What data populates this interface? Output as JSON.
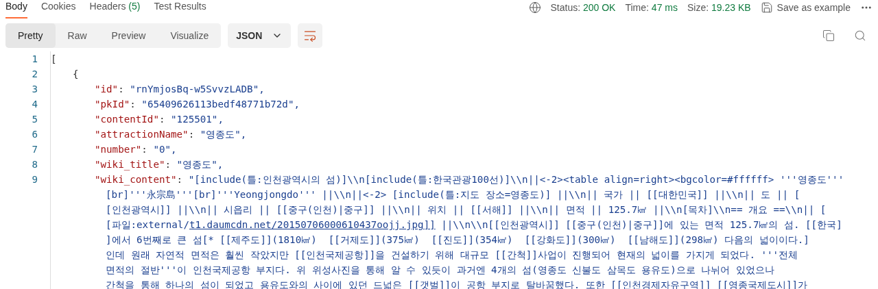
{
  "tabs": [
    {
      "label": "Body",
      "selected": true
    },
    {
      "label": "Cookies",
      "selected": false
    },
    {
      "label": "Headers",
      "count": "(5)",
      "selected": false
    },
    {
      "label": "Test Results",
      "selected": false
    }
  ],
  "status": {
    "items": [
      {
        "label": "Status:",
        "value": "200 OK"
      },
      {
        "label": "Time:",
        "value": "47 ms"
      },
      {
        "label": "Size:",
        "value": "19.23 KB"
      }
    ],
    "save": "Save as example"
  },
  "view_modes": [
    {
      "label": "Pretty",
      "selected": true
    },
    {
      "label": "Raw",
      "selected": false
    },
    {
      "label": "Preview",
      "selected": false
    },
    {
      "label": "Visualize",
      "selected": false
    }
  ],
  "format": "JSON",
  "wrap_lines": true,
  "code": [
    {
      "number": "1",
      "kind": "punct",
      "text": "[",
      "children": [
        {
          "number": "2",
          "kind": "punct",
          "text": "{",
          "children": [
            {
              "number": "3",
              "kind": "pair",
              "key": "\"id\"",
              "separator": ":",
              "value": "\"rnYmjosBq-w5SvvzLADB\","
            },
            {
              "number": "4",
              "kind": "pair",
              "key": "\"pkId\"",
              "separator": ":",
              "value": "\"65409626113bedf48771b72d\","
            },
            {
              "number": "5",
              "kind": "pair",
              "key": "\"contentId\"",
              "separator": ":",
              "value": "\"125501\","
            },
            {
              "number": "6",
              "kind": "pair",
              "key": "\"attractionName\"",
              "separator": ":",
              "value": "\"영종도\","
            },
            {
              "number": "7",
              "kind": "pair",
              "key": "\"number\"",
              "separator": ":",
              "value": "\"0\","
            },
            {
              "number": "8",
              "kind": "pair",
              "key": "\"wiki_title\"",
              "separator": ":",
              "value": "\"영종도\","
            },
            {
              "number": "9",
              "kind": "pair",
              "key": "\"wiki_content\"",
              "separator": ":",
              "value": "\"[include(틀:인천광역시의 섬)]\\\\n[include(틀:한국관광100선)]\\\\n||<-2><table align=right><bgcolor=#ffffff> '''영종도'''",
              "continuation": [
                {
                  "kind": "wrap",
                  "text": "[br]'''永宗島'''[br]'''Yeongjongdo''' ||\\\\n||<-2> [include(틀:지도 장소=영종도)] ||\\\\n|| 국가 || [[대한민국]] ||\\\\n|| 도 || ["
                },
                {
                  "kind": "wrap",
                  "text": "[인천광역시]] ||\\\\n|| 시읍리 || [[중구(인천)|중구]] ||\\\\n|| 위치 || [[서해]] ||\\\\n|| 면적 || 125.7㎢ ||\\\\n[목차]\\\\n== 개요 ==\\\\n|| ["
                },
                {
                  "kind": "link",
                  "before": "[파일:external/",
                  "link": "t1.daumcdn.net/20150706000610437oojj.jpg]]",
                  "after": " ||\\\\n\\\\n[[인천광역시]] [[중구(인천)|중구]]에 있는 면적 125.7㎢의 섬. [[한국]"
                },
                {
                  "kind": "wrap",
                  "text": "]에서 6번째로 큰 섬[* [[제주도]](1810㎢)  [[거제도]](375㎢)  [[진도]](354㎢)  [[강화도]](300㎢)  [[남해도]](298㎢) 다음의 넓이이다.]"
                },
                {
                  "kind": "wrap",
                  "text": "인데 원래 자연적 면적은 훨씬 작았지만 [[인천국제공항]]을 건설하기 위해 대규모 [[간척]]사업이 진행되어 현재의 넓이를 가지게 되었다. '''전체"
                },
                {
                  "kind": "wrap",
                  "text": "면적의 절반'''이 인천국제공항 부지다. 위 위성사진을 통해 알 수 있듯이 과거엔 4개의 섬(영종도 신불도 삼목도 용유도)으로 나뉘어 있었으나"
                },
                {
                  "kind": "wrap",
                  "text": "간척을 통해 하나의 섬이 되었고 용유도와의 사이에 있던 드넓은 [[갯벌]]이 공항 부지로 탈바꿈했다. 또한 [[인천경제자유구역]] [[영종국제도시]]가"
                }
              ]
            }
          ]
        }
      ]
    }
  ]
}
